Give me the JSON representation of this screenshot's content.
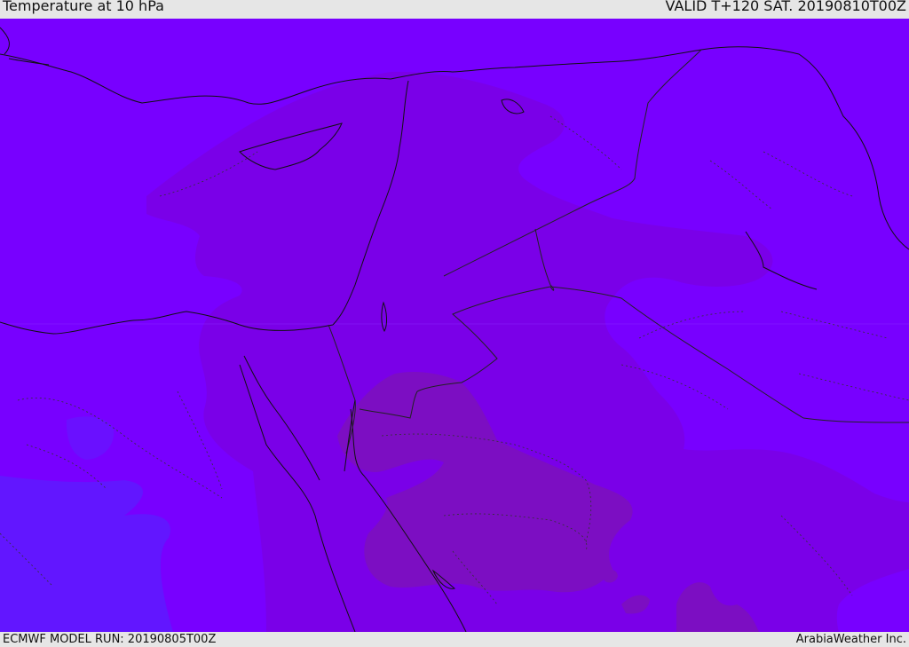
{
  "header": {
    "title": "Temperature at 10 hPa",
    "valid_time": "VALID T+120 SAT. 20190810T00Z"
  },
  "footer": {
    "model_run": "ECMWF MODEL RUN: 20190805T00Z",
    "credit": "ArabiaWeather Inc."
  },
  "colors": {
    "base_field": "#7800ff",
    "warmer_band": "#7a00e8",
    "warmest_band": "#7c0ec2",
    "cool_band": "#6216ff",
    "coastline": "#111111",
    "border": "#222222"
  }
}
